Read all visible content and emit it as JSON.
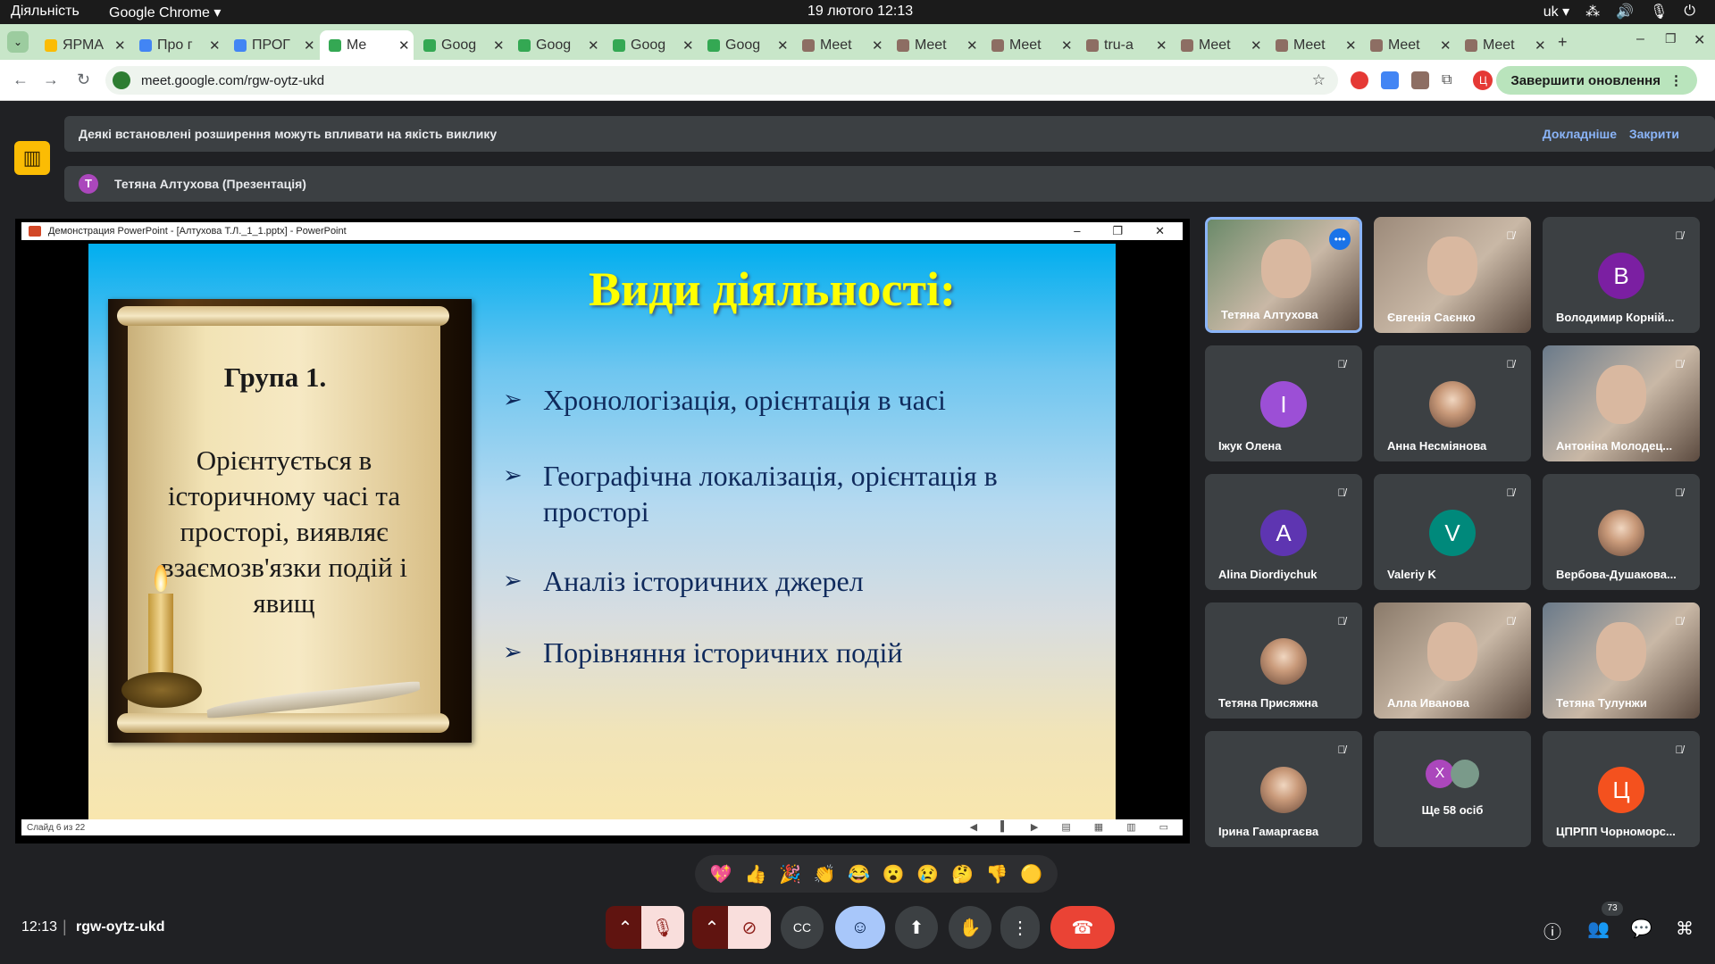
{
  "os": {
    "activities": "Діяльність",
    "app_menu": "Google Chrome ▾",
    "clock": "19 лютого  12:13",
    "keyboard_layout": "uk ▾"
  },
  "tabs": [
    {
      "title": "ЯРМА",
      "color": "#fbbc04"
    },
    {
      "title": "Про г",
      "color": "#4285f4"
    },
    {
      "title": "ПРОГ",
      "color": "#4285f4"
    },
    {
      "title": "Me",
      "color": "#34a853",
      "active": true
    },
    {
      "title": "Goog",
      "color": "#34a853"
    },
    {
      "title": "Goog",
      "color": "#34a853"
    },
    {
      "title": "Goog",
      "color": "#34a853"
    },
    {
      "title": "Goog",
      "color": "#34a853"
    },
    {
      "title": "Meet",
      "color": "#8d6e63"
    },
    {
      "title": "Meet",
      "color": "#8d6e63"
    },
    {
      "title": "Meet",
      "color": "#8d6e63"
    },
    {
      "title": "tru-a",
      "color": "#8d6e63"
    },
    {
      "title": "Meet",
      "color": "#8d6e63"
    },
    {
      "title": "Meet",
      "color": "#8d6e63"
    },
    {
      "title": "Meet",
      "color": "#8d6e63"
    },
    {
      "title": "Meet",
      "color": "#8d6e63"
    }
  ],
  "browser": {
    "url": "meet.google.com/rgw-oytz-ukd",
    "update_button": "Завершити оновлення",
    "profile_initial": "Ц"
  },
  "notice": {
    "message": "Деякі встановлені розширення можуть впливати на якість виклику",
    "more": "Докладніше",
    "close": "Закрити"
  },
  "presenter": {
    "initial": "Т",
    "label": "Тетяна Алтухова (Презентація)"
  },
  "ppt": {
    "window_title": "Демонстрация PowerPoint - [Алтухова Т.Л._1_1.pptx] - PowerPoint",
    "slide_status": "Слайд 6 из 22",
    "slide_title": "Види  діяльності:",
    "group_title": "Група 1.",
    "group_text": "Орієнтується в історичному часі та просторі, виявляє взаємозв'язки подій і явищ",
    "bullets": [
      "Хронологізація, орієнтація в часі",
      "Географічна локалізація, орієнтація в просторі",
      "Аналіз історичних джерел",
      "Порівняння історичних подій"
    ]
  },
  "participants": [
    {
      "name": "Тетяна Алтухова",
      "type": "video",
      "speaking": true
    },
    {
      "name": "Євгенія Саєнко",
      "type": "video"
    },
    {
      "name": "Володимир Корній...",
      "initial": "В",
      "color": "#7b1fa2"
    },
    {
      "name": "Іжук Олена",
      "initial": "І",
      "color": "#9c4fd6"
    },
    {
      "name": "Анна Несміянова",
      "type": "avatar-photo"
    },
    {
      "name": "Антоніна Молодец...",
      "type": "video"
    },
    {
      "name": "Alina Diordiychuk",
      "initial": "A",
      "color": "#5e35b1"
    },
    {
      "name": "Valeriy K",
      "initial": "V",
      "color": "#00897b"
    },
    {
      "name": "Вербова-Душакова...",
      "type": "avatar-photo"
    },
    {
      "name": "Тетяна Присяжна",
      "type": "avatar-photo"
    },
    {
      "name": "Алла Иванова",
      "type": "video"
    },
    {
      "name": "Тетяна Тулунжи",
      "type": "video"
    },
    {
      "name": "Ірина Гамаргаєва",
      "type": "avatar-photo"
    },
    {
      "name": "Ще 58 осіб",
      "type": "more",
      "initial": "X"
    },
    {
      "name": "ЦПРПП Чорноморс...",
      "initial": "Ц",
      "color": "#f4511e"
    }
  ],
  "reactions": [
    "💖",
    "👍",
    "🎉",
    "👏",
    "😂",
    "😮",
    "😢",
    "🤔",
    "👎",
    "🟡"
  ],
  "footer": {
    "time": "12:13",
    "meeting_code": "rgw-oytz-ukd",
    "participants_count": "73"
  }
}
